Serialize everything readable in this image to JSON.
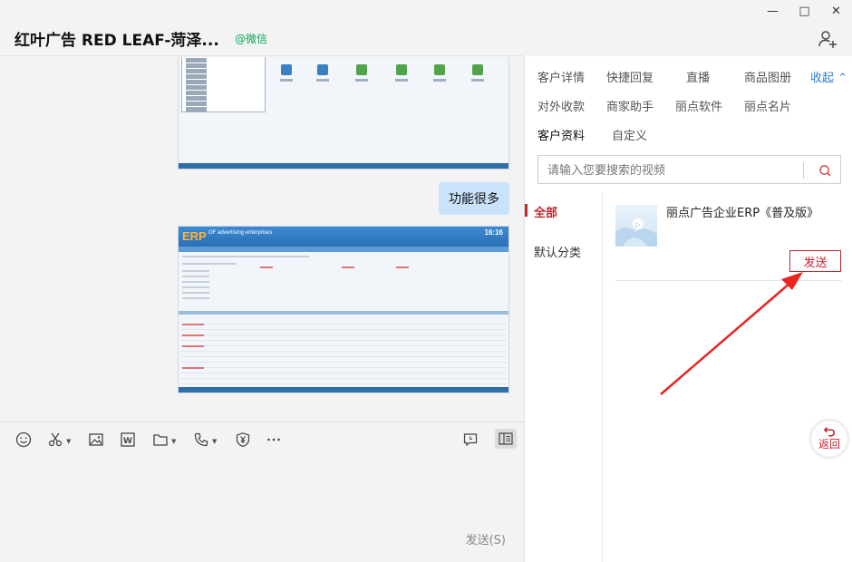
{
  "chat": {
    "title": "红叶广告 RED LEAF-菏泽...",
    "source_tag": "@微信",
    "messages": {
      "bubble_text": "功能很多"
    },
    "send_label": "发送(S)"
  },
  "screenshot2": {
    "logo": "ERP",
    "logo_sub": "OF advertising enterprises",
    "clock": "16:16"
  },
  "side": {
    "tabs_row1": [
      "客户详情",
      "快捷回复",
      "直播",
      "商品图册"
    ],
    "collapse_label": "收起",
    "tabs_row2": [
      "对外收款",
      "商家助手",
      "丽点软件",
      "丽点名片"
    ],
    "tabs_row3": [
      "客户资料",
      "自定义"
    ],
    "search_placeholder": "请输入您要搜索的视频",
    "categories": [
      "全部",
      "默认分类"
    ],
    "item": {
      "title": "丽点广告企业ERP《普及版》",
      "send_label": "发送"
    },
    "back_label": "返回"
  },
  "colors": {
    "accent_red": "#c4262e",
    "link_blue": "#2f7bd6",
    "wechat_green": "#07a557",
    "bubble": "#c9e3fb"
  },
  "icons": [
    "minimize-icon",
    "maximize-icon",
    "close-icon",
    "add-user-icon",
    "emoji-icon",
    "scissors-icon",
    "image-icon",
    "word-icon",
    "folder-icon",
    "phone-icon",
    "shield-yen-icon",
    "more-icon",
    "chat-history-icon",
    "sidebar-toggle-icon",
    "search-icon",
    "back-icon"
  ]
}
